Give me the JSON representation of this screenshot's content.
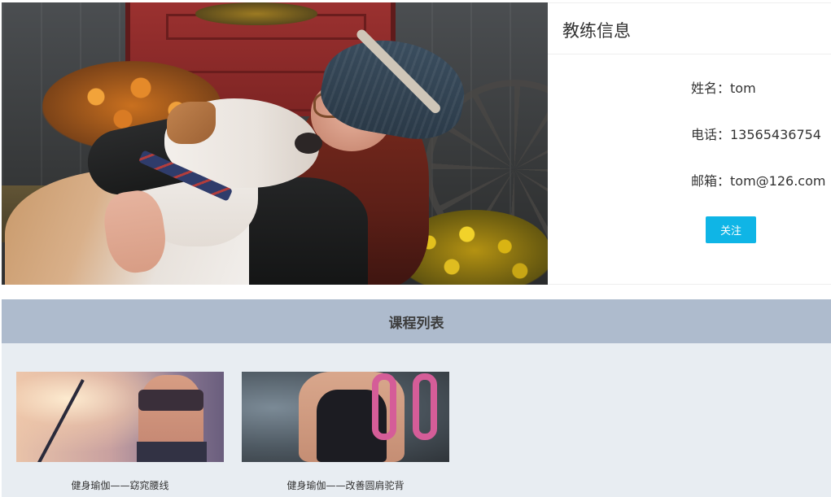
{
  "coach": {
    "title": "教练信息",
    "name": "姓名：tom",
    "phone": "电话：13565436754",
    "email": "邮箱：tom@126.com",
    "follow_label": "关注"
  },
  "courses": {
    "header": "课程列表",
    "items": [
      {
        "caption": "健身瑜伽——窈窕腰线"
      },
      {
        "caption": "健身瑜伽——改善圆肩驼背"
      }
    ]
  },
  "colors": {
    "follow_button": "#0fb5e6",
    "courses_header_bg": "#aebbcd",
    "courses_body_bg": "#e8edf2"
  }
}
